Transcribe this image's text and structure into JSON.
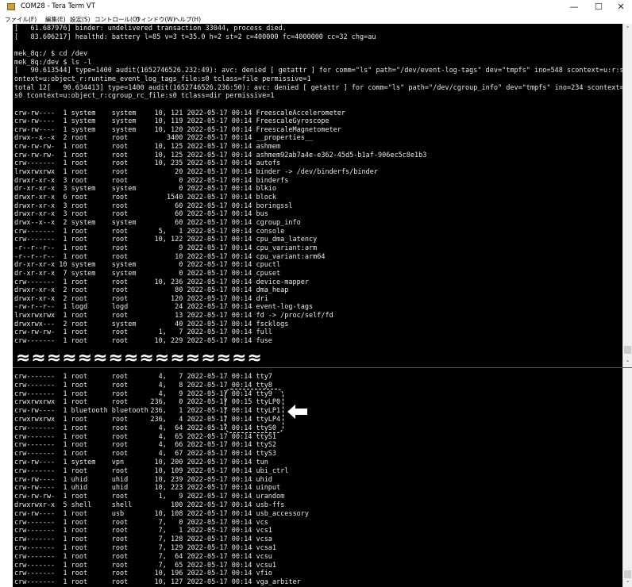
{
  "window": {
    "title": "COM28 - Tera Term VT",
    "controls": {
      "minimize": "—",
      "maximize": "☐",
      "close": "✕"
    }
  },
  "menu": [
    "ファイル(F)",
    "編集(E)",
    "設定(S)",
    "コントロール(O)",
    "ウィンドウ(W)",
    "ヘルプ(H)"
  ],
  "terminal_header": [
    "[   61.687976] binder: undelivered transaction 33044, process died.",
    "[   83.606217] healthd: battery l=85 v=3 t=35.0 h=2 st=2 c=400000 fc=4000000 cc=32 chg=au",
    "",
    "mek_8q:/ $ cd /dev",
    "mek_8q:/dev $ ls -l",
    "[   90.613544] type=1400 audit(1652746526.232:49): avc: denied [ getattr ] for comm=\"ls\" path=\"/dev/event-log-tags\" dev=\"tmpfs\" ino=548 scontext=u:r:shell:s0 tc",
    "ontext=u:object_r:runtime_event_log_tags_file:s0 tclass=file permissive=1",
    "total 12[   90.634413] type=1400 audit(1652746526.236:50): avc: denied [ getattr ] for comm=\"ls\" path=\"/dev/cgroup_info\" dev=\"tmpfs\" ino=234 scontext=u:r:shell:",
    "s0 tcontext=u:object_r:cgroup_rc_file:s0 tclass=dir permissive=1"
  ],
  "listing_top": [
    [
      "crw-rw----",
      "1",
      "system",
      "system",
      "10, 121",
      "2022-05-17",
      "00:14",
      "FreescaleAccelerometer"
    ],
    [
      "crw-rw----",
      "1",
      "system",
      "system",
      "10, 119",
      "2022-05-17",
      "00:14",
      "FreescaleGyroscope"
    ],
    [
      "crw-rw----",
      "1",
      "system",
      "system",
      "10, 120",
      "2022-05-17",
      "00:14",
      "FreescaleMagnetometer"
    ],
    [
      "drwx--x--x",
      "2",
      "root",
      "root",
      "3400",
      "2022-05-17",
      "00:14",
      "__properties__"
    ],
    [
      "crw-rw-rw-",
      "1",
      "root",
      "root",
      "10, 125",
      "2022-05-17",
      "00:14",
      "ashmem"
    ],
    [
      "crw-rw-rw-",
      "1",
      "root",
      "root",
      "10, 125",
      "2022-05-17",
      "00:14",
      "ashmem92ab7a4e-e362-45d5-b1af-906ec5c8e1b3"
    ],
    [
      "crw-------",
      "1",
      "root",
      "root",
      "10, 235",
      "2022-05-17",
      "00:14",
      "autofs"
    ],
    [
      "lrwxrwxrwx",
      "1",
      "root",
      "root",
      "20",
      "2022-05-17",
      "00:14",
      "binder -> /dev/binderfs/binder"
    ],
    [
      "drwxr-xr-x",
      "3",
      "root",
      "root",
      "0",
      "2022-05-17",
      "00:14",
      "binderfs"
    ],
    [
      "dr-xr-xr-x",
      "3",
      "system",
      "system",
      "0",
      "2022-05-17",
      "00:14",
      "blkio"
    ],
    [
      "drwxr-xr-x",
      "6",
      "root",
      "root",
      "1540",
      "2022-05-17",
      "00:14",
      "block"
    ],
    [
      "drwxr-xr-x",
      "3",
      "root",
      "root",
      "60",
      "2022-05-17",
      "00:14",
      "boringssl"
    ],
    [
      "drwxr-xr-x",
      "3",
      "root",
      "root",
      "60",
      "2022-05-17",
      "00:14",
      "bus"
    ],
    [
      "drwx--x--x",
      "2",
      "system",
      "system",
      "60",
      "2022-05-17",
      "00:14",
      "cgroup_info"
    ],
    [
      "crw-------",
      "1",
      "root",
      "root",
      "5,   1",
      "2022-05-17",
      "00:14",
      "console"
    ],
    [
      "crw-------",
      "1",
      "root",
      "root",
      "10, 122",
      "2022-05-17",
      "00:14",
      "cpu_dma_latency"
    ],
    [
      "-r--r--r--",
      "1",
      "root",
      "root",
      "9",
      "2022-05-17",
      "00:14",
      "cpu_variant:arm"
    ],
    [
      "-r--r--r--",
      "1",
      "root",
      "root",
      "10",
      "2022-05-17",
      "00:14",
      "cpu_variant:arm64"
    ],
    [
      "dr-xr-xr-x",
      "10",
      "system",
      "system",
      "0",
      "2022-05-17",
      "00:14",
      "cpuctl"
    ],
    [
      "dr-xr-xr-x",
      "7",
      "system",
      "system",
      "0",
      "2022-05-17",
      "00:14",
      "cpuset"
    ],
    [
      "crw-------",
      "1",
      "root",
      "root",
      "10, 236",
      "2022-05-17",
      "00:14",
      "device-mapper"
    ],
    [
      "drwxr-xr-x",
      "2",
      "root",
      "root",
      "80",
      "2022-05-17",
      "00:14",
      "dma_heap"
    ],
    [
      "drwxr-xr-x",
      "2",
      "root",
      "root",
      "120",
      "2022-05-17",
      "00:14",
      "dri"
    ],
    [
      "-rw-r--r--",
      "1",
      "logd",
      "logd",
      "24",
      "2022-05-17",
      "00:14",
      "event-log-tags"
    ],
    [
      "lrwxrwxrwx",
      "1",
      "root",
      "root",
      "13",
      "2022-05-17",
      "00:14",
      "fd -> /proc/self/fd"
    ],
    [
      "drwxrwx---",
      "2",
      "root",
      "system",
      "40",
      "2022-05-17",
      "00:14",
      "fscklogs"
    ],
    [
      "crw-rw-rw-",
      "1",
      "root",
      "root",
      "1,   7",
      "2022-05-17",
      "00:14",
      "full"
    ],
    [
      "crw-------",
      "1",
      "root",
      "root",
      "10, 229",
      "2022-05-17",
      "00:14",
      "fuse"
    ]
  ],
  "break_marker": "≈≈≈≈≈≈≈≈≈≈≈≈≈≈≈≈",
  "listing_bottom": [
    [
      "crw-------",
      "1",
      "root",
      "root",
      "4,   7",
      "2022-05-17",
      "00:14",
      "tty7"
    ],
    [
      "crw-------",
      "1",
      "root",
      "root",
      "4,   8",
      "2022-05-17",
      "00:14",
      "tty8"
    ],
    [
      "crw-------",
      "1",
      "root",
      "root",
      "4,   9",
      "2022-05-17",
      "00:14",
      "tty9"
    ],
    [
      "crwxrwxrwx",
      "1",
      "root",
      "root",
      "236,   0",
      "2022-05-17",
      "00:15",
      "ttyLP0"
    ],
    [
      "crw-rw----",
      "1",
      "bluetooth",
      "bluetooth",
      "236,   1",
      "2022-05-17",
      "00:14",
      "ttyLP1"
    ],
    [
      "crwxrwxrwx",
      "1",
      "root",
      "root",
      "236,   4",
      "2022-05-17",
      "00:14",
      "ttyLP4"
    ],
    [
      "crw-------",
      "1",
      "root",
      "root",
      "4,  64",
      "2022-05-17",
      "00:14",
      "ttyS0"
    ],
    [
      "crw-------",
      "1",
      "root",
      "root",
      "4,  65",
      "2022-05-17",
      "00:14",
      "ttyS1"
    ],
    [
      "crw-------",
      "1",
      "root",
      "root",
      "4,  66",
      "2022-05-17",
      "00:14",
      "ttyS2"
    ],
    [
      "crw-------",
      "1",
      "root",
      "root",
      "4,  67",
      "2022-05-17",
      "00:14",
      "ttyS3"
    ],
    [
      "crw-rw----",
      "1",
      "system",
      "vpn",
      "10, 200",
      "2022-05-17",
      "00:14",
      "tun"
    ],
    [
      "crw-------",
      "1",
      "root",
      "root",
      "10, 109",
      "2022-05-17",
      "00:14",
      "ubi_ctrl"
    ],
    [
      "crw-rw----",
      "1",
      "uhid",
      "uhid",
      "10, 239",
      "2022-05-17",
      "00:14",
      "uhid"
    ],
    [
      "crw-rw----",
      "1",
      "uhid",
      "uhid",
      "10, 223",
      "2022-05-17",
      "00:14",
      "uinput"
    ],
    [
      "crw-rw-rw-",
      "1",
      "root",
      "root",
      "1,   9",
      "2022-05-17",
      "00:14",
      "urandom"
    ],
    [
      "drwxrwxr-x",
      "5",
      "shell",
      "shell",
      "100",
      "2022-05-17",
      "00:14",
      "usb-ffs"
    ],
    [
      "crw-rw----",
      "1",
      "root",
      "usb",
      "10, 108",
      "2022-05-17",
      "00:14",
      "usb_accessory"
    ],
    [
      "crw-------",
      "1",
      "root",
      "root",
      "7,   0",
      "2022-05-17",
      "00:14",
      "vcs"
    ],
    [
      "crw-------",
      "1",
      "root",
      "root",
      "7,   1",
      "2022-05-17",
      "00:14",
      "vcs1"
    ],
    [
      "crw-------",
      "1",
      "root",
      "root",
      "7, 128",
      "2022-05-17",
      "00:14",
      "vcsa"
    ],
    [
      "crw-------",
      "1",
      "root",
      "root",
      "7, 129",
      "2022-05-17",
      "00:14",
      "vcsa1"
    ],
    [
      "crw-------",
      "1",
      "root",
      "root",
      "7,  64",
      "2022-05-17",
      "00:14",
      "vcsu"
    ],
    [
      "crw-------",
      "1",
      "root",
      "root",
      "7,  65",
      "2022-05-17",
      "00:14",
      "vcsu1"
    ],
    [
      "crw-------",
      "1",
      "root",
      "root",
      "10, 196",
      "2022-05-17",
      "00:14",
      "vfio"
    ],
    [
      "crw-------",
      "1",
      "root",
      "root",
      "10, 127",
      "2022-05-17",
      "00:14",
      "vga_arbiter"
    ]
  ],
  "colors": {
    "terminal_bg": "#000000",
    "terminal_fg": "#e8e8e8",
    "annotation": "#ffffff"
  }
}
